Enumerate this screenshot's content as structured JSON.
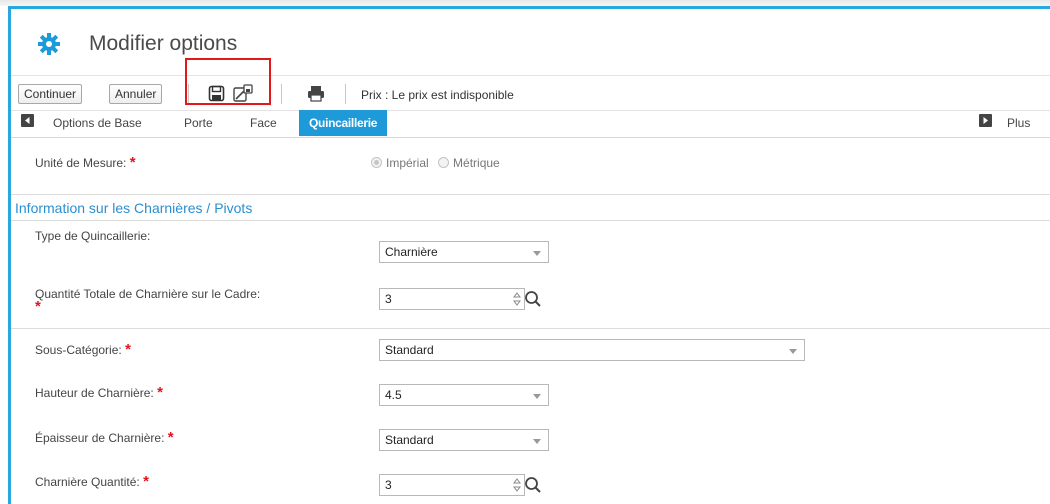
{
  "window": {
    "title": "Modifier options",
    "accent": "#29a8e0"
  },
  "toolbar": {
    "continue_label": "Continuer",
    "cancel_label": "Annuler",
    "icons": [
      "save-icon",
      "save-as-icon",
      "print-icon"
    ],
    "price_text": "Prix : Le prix est indisponible",
    "highlight_color": "#e1191b"
  },
  "tabs": {
    "items": [
      "Options de Base",
      "Porte",
      "Face",
      "Quincaillerie"
    ],
    "active": "Quincaillerie",
    "more_label": "Plus",
    "active_color": "#1e9ad9"
  },
  "form": {
    "unit": {
      "label": "Unité de Mesure:",
      "required_mark": "*",
      "options": [
        "Impérial",
        "Métrique"
      ],
      "selected": "Impérial"
    },
    "section_title": "Information sur les Charnières / Pivots",
    "hardware_type": {
      "label": "Type de Quincaillerie:",
      "value": "Charnière"
    },
    "total_qty": {
      "label": "Quantité Totale de Charnière sur le Cadre:",
      "required_mark": "*",
      "value": "3"
    },
    "subcategory": {
      "label": "Sous-Catégorie:",
      "required_mark": "*",
      "value": "Standard"
    },
    "hinge_height": {
      "label": "Hauteur de Charnière:",
      "required_mark": "*",
      "value": "4.5"
    },
    "hinge_thickness": {
      "label": "Épaisseur de Charnière:",
      "required_mark": "*",
      "value": "Standard"
    },
    "hinge_qty": {
      "label": "Charnière Quantité:",
      "required_mark": "*",
      "value": "3"
    }
  }
}
